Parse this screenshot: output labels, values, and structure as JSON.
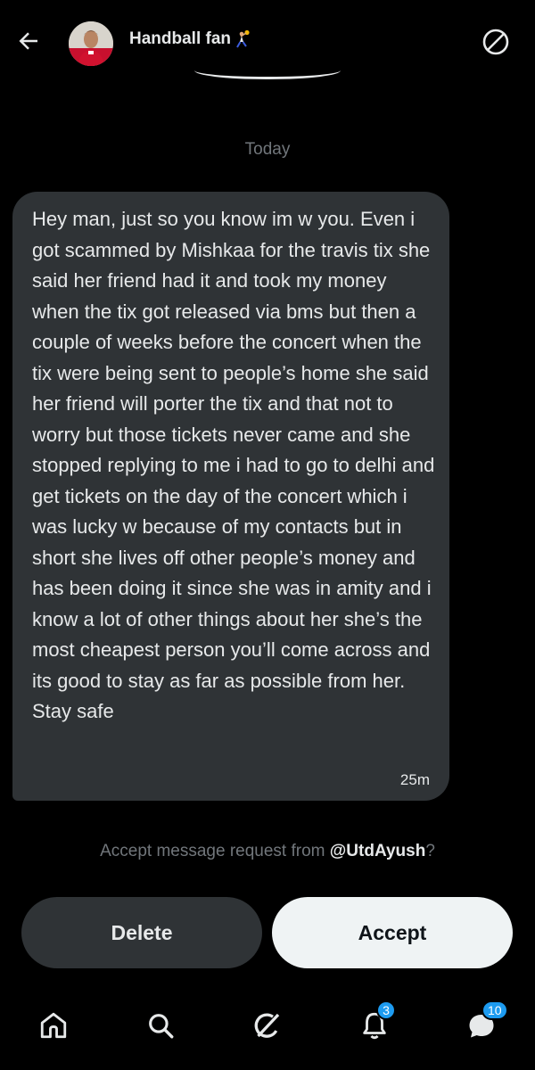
{
  "header": {
    "back_icon": "arrow-left-icon",
    "title": "Handball fan",
    "title_emoji": "handball-icon",
    "info_icon": "circle-slash-icon"
  },
  "conversation": {
    "date_label": "Today",
    "message": {
      "text": "Hey man, just so you know im w you. Even i got scammed by Mishkaa for the travis tix she said her friend had it and took my money when the tix got released via bms but then a couple of weeks before the concert when the tix were being sent to people’s home she said her friend will porter the tix and that not to worry but those tickets never came and she stopped replying to me i had to go to delhi and get tickets on the day of the concert which i was lucky w because of my contacts but in short she lives off other people’s money and has been doing it since she was in amity and i know a lot of other things about her she’s the most cheapest person you’ll come across and its good to stay as far as possible from her. Stay safe",
      "time": "25m"
    }
  },
  "request": {
    "prefix": "Accept message request from ",
    "handle": "@UtdAyush",
    "suffix": "?"
  },
  "actions": {
    "delete_label": "Delete",
    "accept_label": "Accept"
  },
  "bottom_nav": {
    "items": [
      {
        "icon": "home-icon"
      },
      {
        "icon": "search-icon"
      },
      {
        "icon": "grok-icon"
      },
      {
        "icon": "bell-icon",
        "badge": "3"
      },
      {
        "icon": "messages-icon",
        "badge": "10"
      }
    ]
  },
  "colors": {
    "background": "#000000",
    "bubble": "#2f3336",
    "muted_text": "#71767b",
    "accent": "#1d9bf0"
  }
}
